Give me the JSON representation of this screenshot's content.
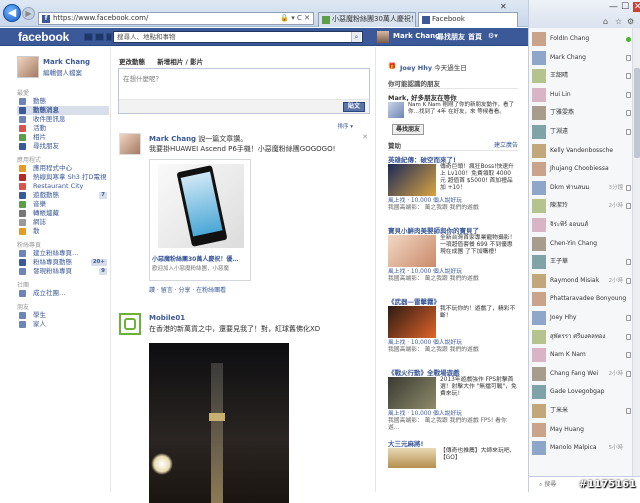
{
  "browser": {
    "url": "https://www.facebook.com/",
    "tabs": [
      {
        "label": "小惡魔粉絲團30萬人慶祝！優..."
      },
      {
        "label": "Facebook"
      }
    ],
    "win_min": "—",
    "win_max": "☐",
    "win_close": "✕"
  },
  "fb": {
    "logo": "facebook",
    "search_placeholder": "搜尋人、地點和事物",
    "user": "Mark Chang",
    "find_friends": "尋找朋友",
    "home": "首頁"
  },
  "lnav": {
    "name": "Mark Chang",
    "edit": "編輯個人檔案",
    "sections": [
      {
        "title": "最愛",
        "items": [
          {
            "label": "動態",
            "color": "#6d84b4"
          },
          {
            "label": "動態消息",
            "color": "#3b5998",
            "selected": true
          },
          {
            "label": "收件匣訊息",
            "color": "#6d84b4"
          },
          {
            "label": "活動",
            "color": "#d9534f"
          },
          {
            "label": "相片",
            "color": "#5c9e4a"
          },
          {
            "label": "尋找朋友",
            "color": "#3b5998"
          }
        ]
      },
      {
        "title": "應用程式",
        "items": [
          {
            "label": "應用程式中心",
            "color": "#e39b2a"
          },
          {
            "label": "熱線與寒拿 Sh3 打D電視",
            "color": "#b12b2b"
          },
          {
            "label": "Restaurant City",
            "color": "#d9534f"
          },
          {
            "label": "遊戲動態",
            "color": "#3b5998",
            "count": "7"
          },
          {
            "label": "音樂",
            "color": "#5c9e4a"
          },
          {
            "label": "轉帳爐藏",
            "color": "#777"
          },
          {
            "label": "網誌",
            "color": "#999"
          },
          {
            "label": "散",
            "color": "#e39b2a"
          }
        ]
      },
      {
        "title": "粉絲專頁",
        "items": [
          {
            "label": "建立粉絲專頁…",
            "color": "#6d84b4"
          },
          {
            "label": "粉絲專頁動態",
            "color": "#3b5998",
            "count": "20+"
          },
          {
            "label": "發現粉絲專頁",
            "color": "#6d84b4",
            "count": "9"
          }
        ]
      },
      {
        "title": "社團",
        "items": [
          {
            "label": "成立社團…",
            "color": "#6d84b4"
          }
        ]
      },
      {
        "title": "朋友",
        "items": [
          {
            "label": "學生",
            "color": "#6d84b4"
          },
          {
            "label": "家人",
            "color": "#6d84b4"
          }
        ]
      }
    ]
  },
  "composer": {
    "tab1": "更改動態",
    "tab2": "新增相片 / 影片",
    "placeholder": "在想什麼呢？",
    "post": "貼文",
    "sort": "排序 ▾"
  },
  "stories": [
    {
      "author": "Mark Chang",
      "verb": "說一篇文章讚。",
      "text": "我要掛HUAWEI Ascend P6手機！小惡魔粉絲團GOGOGO!",
      "link_title": "小惡魔粉絲團30萬人慶祝！優…",
      "link_sub": "歡迎加入小惡魔粉絲團，小惡魔",
      "actions": "讚 · 留言 · 分享 · 在粉絲團看"
    },
    {
      "author": "Mobile01",
      "verb": "",
      "text": "在香港的新萬貨之中，還要見我了！對，紅球舊佛化XD"
    }
  ],
  "right": {
    "birthday": {
      "name": "Joey Hhy",
      "text": "今天過生日"
    },
    "suggest": {
      "title": "你可能認識的朋友",
      "more": "全部",
      "name": "Mark, 好多朋友在等你",
      "desc": "Nam K Nam 剛剛了你的新朋友動作，看了你…找到了 4年 在好友，來 等候看看。",
      "btn": "尋找朋友"
    },
    "ads_title": "贊助",
    "ads_more": "建立廣告",
    "ads": [
      {
        "title": "英雄紀傳：破空而來了!",
        "desc": "傳奇巨頭！瘋狂Boss!快速升上 Lv100！免費領取 4000 元 超值首 $5000! 首加禮品 加 +10！",
        "like": "風上找 · 10,000 個人說好玩",
        "like2": "我國高端影： 萬之我跟 我們的遊戲",
        "c1": "#1b2a58",
        "c2": "#d9a441"
      },
      {
        "title": "寶貝小鮮肉美嬰師與你的寶貝了",
        "desc": "全新台灣首家專業寵物攝影！一項超值套餐 699 不到優惠現在成團 了下加購禮！",
        "like": "風上找 · 10,000 個人說好玩",
        "like2": "我國高端影： 萬之我跟 我們的遊戲",
        "c1": "#f3d8c4",
        "c2": "#c98a6b"
      },
      {
        "title": "《武器—雷擊霧》",
        "desc": "我不玩你的！遊戲了，精彩不斷！",
        "like": "風上找 · 10,000 個人說好玩",
        "like2": "我國高端影： 萬之我跟 我們的遊戲",
        "c1": "#2c1b12",
        "c2": "#e0642a"
      },
      {
        "title": "《戰火行動》全戰場遊戲",
        "desc": "2013年遊戲強作 FPS射擊首選！射擊大作 \"無擋可戰\"，免費來玩！",
        "like": "風上找 · 10,000 個人說好玩",
        "like2": "我國高端影： 萬之我跟 我們的遊戲 FPS! 看你遊…",
        "c1": "#3a3a32",
        "c2": "#8e8b6a"
      }
    ],
    "last_ad_title": "大三元麻將!",
    "last_ad_desc": "【傳奇也推薦】大師來玩吧,【GO】"
  },
  "chat": {
    "contacts": [
      {
        "name": "FoldIn Chang",
        "online": true
      },
      {
        "name": "Mark Chang",
        "icon": true
      },
      {
        "name": "王韶晴",
        "icon": true
      },
      {
        "name": "Hui Lin",
        "icon": true
      },
      {
        "name": "丁雅雯燕",
        "icon": true
      },
      {
        "name": "丁淵遠",
        "icon": true
      },
      {
        "name": "Kelly Vandenbossche",
        "icon": false
      },
      {
        "name": "Jhujang Choobiessa",
        "icon": false
      },
      {
        "name": "Dkm ฟ่านสนม",
        "time": "3分鐘",
        "icon": true
      },
      {
        "name": "陳潔玲",
        "time": "2小時",
        "icon": true
      },
      {
        "name": "จิระพีร์ ออนนส์",
        "icon": false
      },
      {
        "name": "Chen-Yin Chang",
        "icon": false
      },
      {
        "name": "王子華",
        "icon": true
      },
      {
        "name": "Raymond Misiak",
        "time": "2小時",
        "icon": true
      },
      {
        "name": "Phattaravadee Bonyoung",
        "icon": false
      },
      {
        "name": "Joey Hhy",
        "icon": true
      },
      {
        "name": "สุพัตรรา ศรีมงคลทอง",
        "icon": true
      },
      {
        "name": "Nam K Nam",
        "icon": true
      },
      {
        "name": "Chang Fang Wei",
        "time": "2小時",
        "icon": true
      },
      {
        "name": "Gade Lovegobgap",
        "icon": false
      },
      {
        "name": "丁米米",
        "icon": true
      },
      {
        "name": "May Huang",
        "icon": false
      },
      {
        "name": "Manolo Malpica",
        "time": "5小時",
        "icon": false
      }
    ],
    "search": "搜尋"
  },
  "watermark": "#1175161"
}
